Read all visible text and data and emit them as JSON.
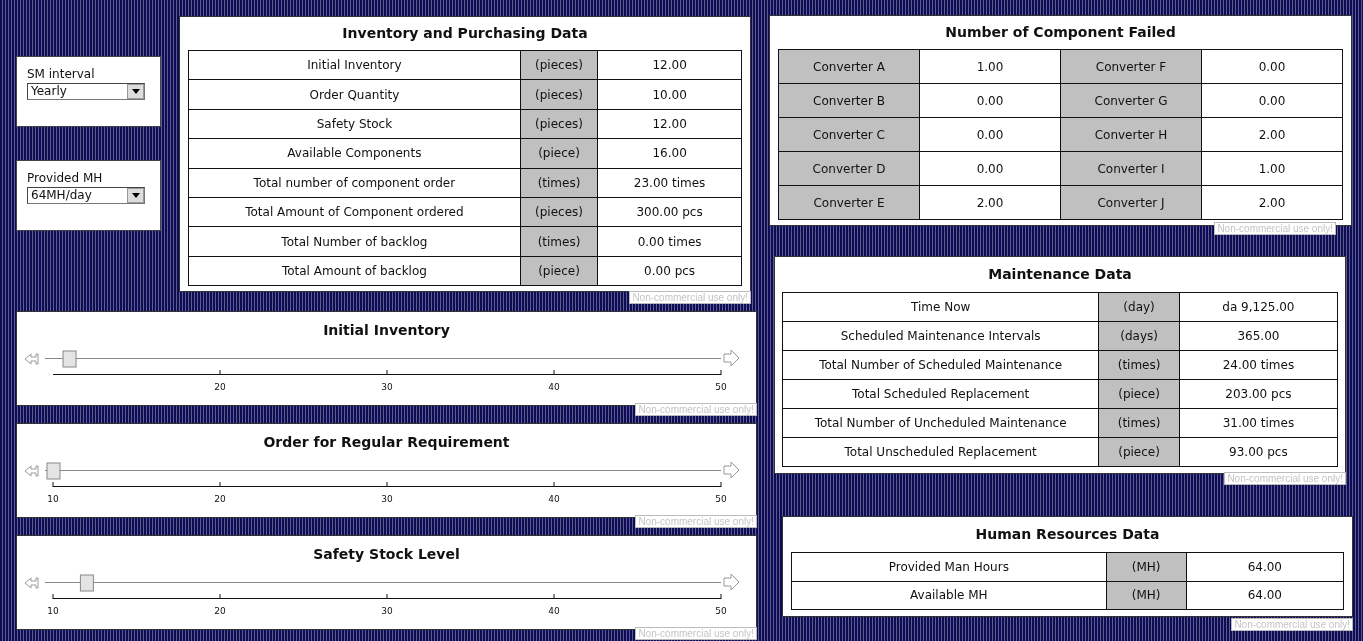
{
  "controls": [
    {
      "label": "SM interval",
      "value": "Yearly"
    },
    {
      "label": "Provided MH",
      "value": "64MH/day"
    }
  ],
  "inventory": {
    "title": "Inventory and Purchasing Data",
    "rows": [
      {
        "label": "Initial Inventory",
        "unit": "(pieces)",
        "value": "12.00"
      },
      {
        "label": "Order Quantity",
        "unit": "(pieces)",
        "value": "10.00"
      },
      {
        "label": "Safety Stock",
        "unit": "(pieces)",
        "value": "12.00"
      },
      {
        "label": "Available Components",
        "unit": "(piece)",
        "value": "16.00"
      },
      {
        "label": "Total number of component order",
        "unit": "(times)",
        "value": "23.00 times"
      },
      {
        "label": "Total Amount of Component ordered",
        "unit": "(pieces)",
        "value": "300.00 pcs"
      },
      {
        "label": "Total Number of backlog",
        "unit": "(times)",
        "value": "0.00 times"
      },
      {
        "label": "Total Amount of backlog",
        "unit": "(piece)",
        "value": "0.00 pcs"
      }
    ],
    "notice": "Non-commercial use only!"
  },
  "sliders": [
    {
      "title": "Initial Inventory",
      "level": 0.024,
      "ticks": [
        "20",
        "30",
        "40",
        "50"
      ],
      "notice": "Non-commercial use only!"
    },
    {
      "title": "Order for Regular Requirement",
      "level": 0.0,
      "ticks": [
        "10",
        "20",
        "30",
        "40",
        "50"
      ],
      "notice": "Non-commercial use only!"
    },
    {
      "title": "Safety Stock Level",
      "level": 0.05,
      "ticks": [
        "10",
        "20",
        "30",
        "40",
        "50"
      ],
      "notice": "Non-commercial use only!"
    }
  ],
  "components_failed": {
    "title": "Number of Component Failed",
    "items": [
      {
        "name": "Converter A",
        "value": "1.00"
      },
      {
        "name": "Converter B",
        "value": "0.00"
      },
      {
        "name": "Converter C",
        "value": "0.00"
      },
      {
        "name": "Converter D",
        "value": "0.00"
      },
      {
        "name": "Converter E",
        "value": "2.00"
      },
      {
        "name": "Converter F",
        "value": "0.00"
      },
      {
        "name": "Converter G",
        "value": "0.00"
      },
      {
        "name": "Converter H",
        "value": "2.00"
      },
      {
        "name": "Converter I",
        "value": "1.00"
      },
      {
        "name": "Converter J",
        "value": "2.00"
      }
    ],
    "notice": "Non-commercial use only!"
  },
  "maintenance": {
    "title": "Maintenance Data",
    "rows": [
      {
        "label": "Time Now",
        "unit": "(day)",
        "value": "da 9,125.00"
      },
      {
        "label": "Scheduled Maintenance Intervals",
        "unit": "(days)",
        "value": "365.00"
      },
      {
        "label": "Total Number of Scheduled Maintenance",
        "unit": "(times)",
        "value": "24.00 times"
      },
      {
        "label": "Total Scheduled Replacement",
        "unit": "(piece)",
        "value": "203.00 pcs"
      },
      {
        "label": "Total Number of Uncheduled Maintenance",
        "unit": "(times)",
        "value": "31.00 times"
      },
      {
        "label": "Total Unscheduled Replacement",
        "unit": "(piece)",
        "value": "93.00 pcs"
      }
    ],
    "notice": "Non-commercial use only!"
  },
  "human_resources": {
    "title": "Human Resources Data",
    "rows": [
      {
        "label": "Provided Man Hours",
        "unit": "(MH)",
        "value": "64.00"
      },
      {
        "label": "Available MH",
        "unit": "(MH)",
        "value": "64.00"
      }
    ],
    "notice": "Non-commercial use only!"
  }
}
